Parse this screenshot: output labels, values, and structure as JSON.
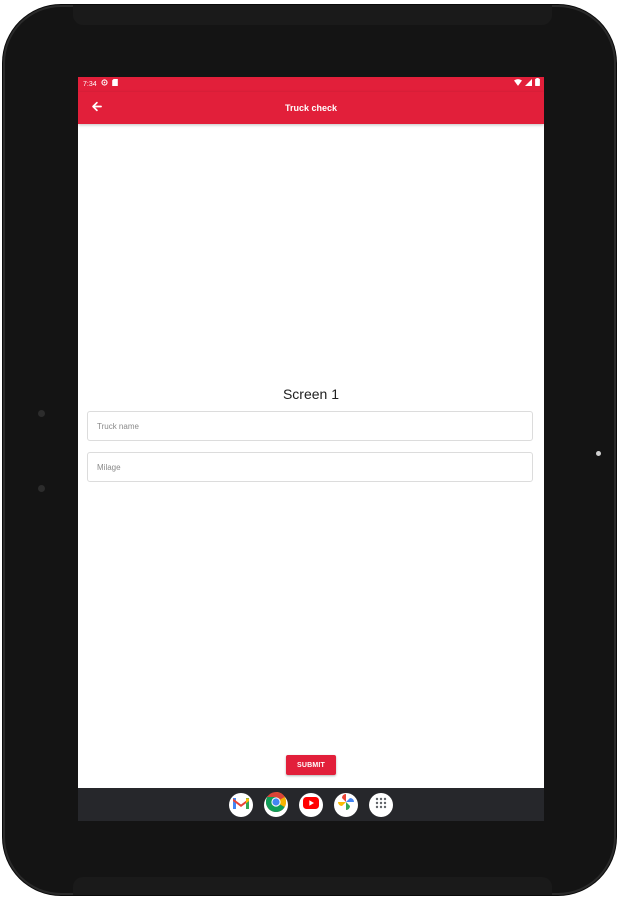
{
  "status_bar": {
    "time": "7:34",
    "icons": [
      "settings-icon",
      "sim-card-icon",
      "wifi-icon",
      "signal-icon",
      "battery-icon"
    ]
  },
  "app_bar": {
    "title": "Truck check",
    "back_icon": "arrow-left-icon"
  },
  "main": {
    "heading": "Screen 1",
    "truck_name": {
      "placeholder": "Truck name",
      "value": ""
    },
    "milage": {
      "placeholder": "Milage",
      "value": ""
    },
    "submit_label": "SUBMIT"
  },
  "dock": {
    "apps": [
      "gmail-icon",
      "chrome-icon",
      "youtube-icon",
      "photos-icon",
      "app-drawer-icon"
    ]
  },
  "colors": {
    "accent": "#e21f3a",
    "device_frame": "#141414",
    "dock_background": "#26272b",
    "screen_background": "#ffffff"
  }
}
